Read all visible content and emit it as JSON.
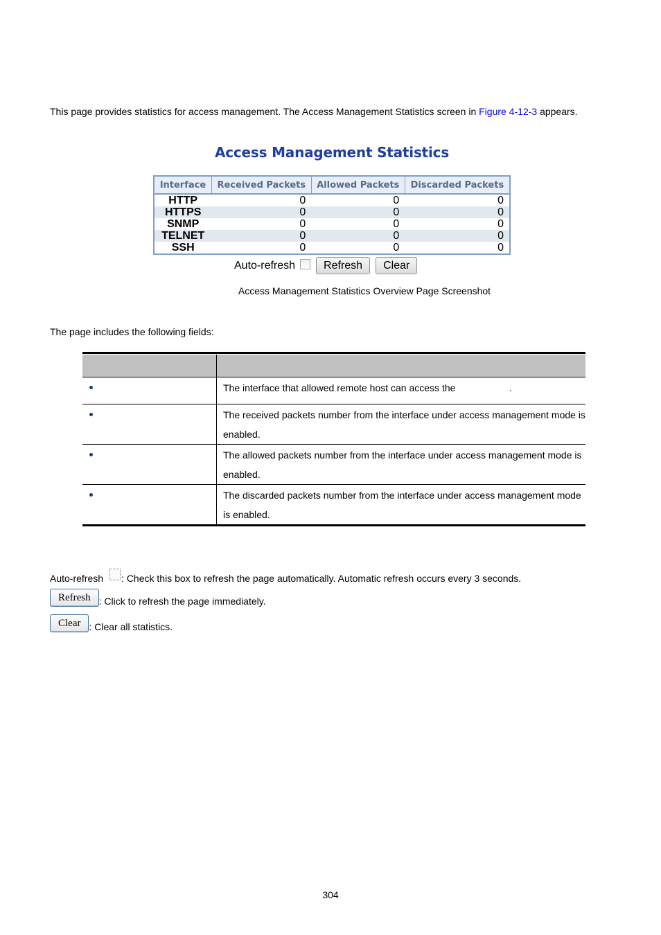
{
  "intro": {
    "text_before": "This page provides statistics for access management. The Access Management Statistics screen in ",
    "link": "Figure 4-12-3",
    "text_after": " appears."
  },
  "figure": {
    "title": "Access Management Statistics",
    "columns": [
      "Interface",
      "Received Packets",
      "Allowed Packets",
      "Discarded Packets"
    ],
    "rows": [
      {
        "interface": "HTTP",
        "received": "0",
        "allowed": "0",
        "discarded": "0"
      },
      {
        "interface": "HTTPS",
        "received": "0",
        "allowed": "0",
        "discarded": "0"
      },
      {
        "interface": "SNMP",
        "received": "0",
        "allowed": "0",
        "discarded": "0"
      },
      {
        "interface": "TELNET",
        "received": "0",
        "allowed": "0",
        "discarded": "0"
      },
      {
        "interface": "SSH",
        "received": "0",
        "allowed": "0",
        "discarded": "0"
      }
    ],
    "auto_refresh_label": "Auto-refresh",
    "auto_refresh_checked": false,
    "refresh_button": "Refresh",
    "clear_button": "Clear",
    "caption": "Access Management Statistics Overview Page Screenshot"
  },
  "fields_intro": "The page includes the following fields:",
  "fields_table": {
    "headers": [
      "",
      ""
    ],
    "rows": [
      {
        "object": "",
        "description": "The interface that allowed remote host can access the                    ."
      },
      {
        "object": "",
        "description": "The received packets number from the interface under access management mode is enabled."
      },
      {
        "object": "",
        "description": "The allowed packets number from the interface under access management mode is enabled."
      },
      {
        "object": "",
        "description": "The discarded packets number from the interface under access management mode is enabled."
      }
    ]
  },
  "buttons_help": {
    "auto_refresh_label": "Auto-refresh",
    "auto_refresh_text": ": Check this box to refresh the page automatically. Automatic refresh occurs every 3 seconds.",
    "refresh_button": "Refresh",
    "refresh_text": ": Click to refresh the page immediately.",
    "clear_button": "Clear",
    "clear_text": ": Clear all statistics."
  },
  "page_number": "304"
}
